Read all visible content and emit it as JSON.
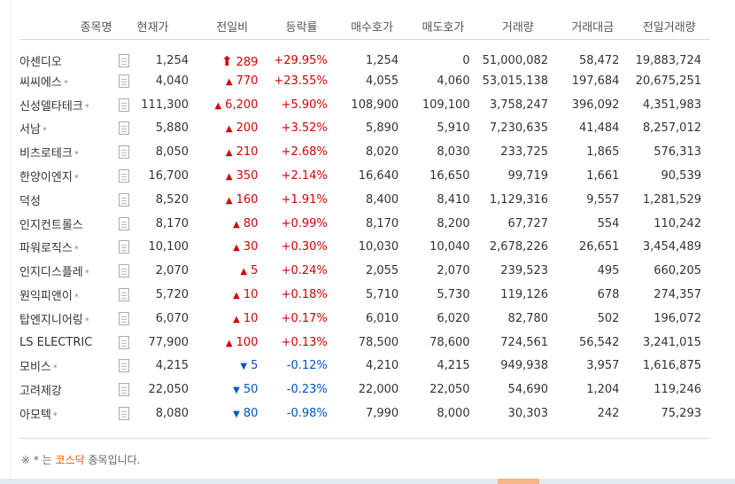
{
  "headers": [
    "종목명",
    "현재가",
    "전일비",
    "등락률",
    "매수호가",
    "매도호가",
    "거래량",
    "거래대금",
    "전일거래량"
  ],
  "rows": [
    {
      "name": "아센디오",
      "kosdaq": false,
      "price": "1,254",
      "dir": "limit",
      "change": "289",
      "rate": "+29.95%",
      "bid": "1,254",
      "ask": "0",
      "volume": "51,000,082",
      "amount": "58,472",
      "prev_volume": "19,883,724"
    },
    {
      "name": "씨씨에스",
      "kosdaq": true,
      "price": "4,040",
      "dir": "up",
      "change": "770",
      "rate": "+23.55%",
      "bid": "4,055",
      "ask": "4,060",
      "volume": "53,015,138",
      "amount": "197,684",
      "prev_volume": "20,675,251"
    },
    {
      "name": "신성델타테크",
      "kosdaq": true,
      "price": "111,300",
      "dir": "up",
      "change": "6,200",
      "rate": "+5.90%",
      "bid": "108,900",
      "ask": "109,100",
      "volume": "3,758,247",
      "amount": "396,092",
      "prev_volume": "4,351,983"
    },
    {
      "name": "서남",
      "kosdaq": true,
      "price": "5,880",
      "dir": "up",
      "change": "200",
      "rate": "+3.52%",
      "bid": "5,890",
      "ask": "5,910",
      "volume": "7,230,635",
      "amount": "41,484",
      "prev_volume": "8,257,012"
    },
    {
      "name": "비츠로테크",
      "kosdaq": true,
      "price": "8,050",
      "dir": "up",
      "change": "210",
      "rate": "+2.68%",
      "bid": "8,020",
      "ask": "8,030",
      "volume": "233,725",
      "amount": "1,865",
      "prev_volume": "576,313"
    },
    {
      "name": "한양이엔지",
      "kosdaq": true,
      "price": "16,700",
      "dir": "up",
      "change": "350",
      "rate": "+2.14%",
      "bid": "16,640",
      "ask": "16,650",
      "volume": "99,719",
      "amount": "1,661",
      "prev_volume": "90,539"
    },
    {
      "name": "덕성",
      "kosdaq": false,
      "price": "8,520",
      "dir": "up",
      "change": "160",
      "rate": "+1.91%",
      "bid": "8,400",
      "ask": "8,410",
      "volume": "1,129,316",
      "amount": "9,557",
      "prev_volume": "1,281,529"
    },
    {
      "name": "인지컨트롤스",
      "kosdaq": false,
      "price": "8,170",
      "dir": "up",
      "change": "80",
      "rate": "+0.99%",
      "bid": "8,170",
      "ask": "8,200",
      "volume": "67,727",
      "amount": "554",
      "prev_volume": "110,242"
    },
    {
      "name": "파워로직스",
      "kosdaq": true,
      "price": "10,100",
      "dir": "up",
      "change": "30",
      "rate": "+0.30%",
      "bid": "10,030",
      "ask": "10,040",
      "volume": "2,678,226",
      "amount": "26,651",
      "prev_volume": "3,454,489"
    },
    {
      "name": "인지디스플레",
      "kosdaq": true,
      "price": "2,070",
      "dir": "up",
      "change": "5",
      "rate": "+0.24%",
      "bid": "2,055",
      "ask": "2,070",
      "volume": "239,523",
      "amount": "495",
      "prev_volume": "660,205"
    },
    {
      "name": "원익피앤이",
      "kosdaq": true,
      "price": "5,720",
      "dir": "up",
      "change": "10",
      "rate": "+0.18%",
      "bid": "5,710",
      "ask": "5,730",
      "volume": "119,126",
      "amount": "678",
      "prev_volume": "274,357"
    },
    {
      "name": "탑엔지니어링",
      "kosdaq": true,
      "price": "6,070",
      "dir": "up",
      "change": "10",
      "rate": "+0.17%",
      "bid": "6,010",
      "ask": "6,020",
      "volume": "82,780",
      "amount": "502",
      "prev_volume": "196,072"
    },
    {
      "name": "LS ELECTRIC",
      "kosdaq": false,
      "price": "77,900",
      "dir": "up",
      "change": "100",
      "rate": "+0.13%",
      "bid": "78,500",
      "ask": "78,600",
      "volume": "724,561",
      "amount": "56,542",
      "prev_volume": "3,241,015"
    },
    {
      "name": "모비스",
      "kosdaq": true,
      "price": "4,215",
      "dir": "down",
      "change": "5",
      "rate": "-0.12%",
      "bid": "4,210",
      "ask": "4,215",
      "volume": "949,938",
      "amount": "3,957",
      "prev_volume": "1,616,875"
    },
    {
      "name": "고려제강",
      "kosdaq": false,
      "price": "22,050",
      "dir": "down",
      "change": "50",
      "rate": "-0.23%",
      "bid": "22,000",
      "ask": "22,050",
      "volume": "54,690",
      "amount": "1,204",
      "prev_volume": "119,246"
    },
    {
      "name": "아모텍",
      "kosdaq": true,
      "price": "8,080",
      "dir": "down",
      "change": "80",
      "rate": "-0.98%",
      "bid": "7,990",
      "ask": "8,000",
      "volume": "30,303",
      "amount": "242",
      "prev_volume": "75,293"
    }
  ],
  "kosdaq_mark": "*",
  "arrows": {
    "limit": "⬆",
    "up": "▲",
    "down": "▼"
  },
  "footnote": {
    "prefix": "※ * 는 ",
    "highlight": "코스닥",
    "suffix": " 종목입니다."
  },
  "colors": {
    "up": "#d60000",
    "down": "#0051c7",
    "highlight": "#e95d00"
  },
  "icons": {
    "document": "document-icon",
    "limit_up": "limit-up-arrow-icon",
    "up": "up-triangle-icon",
    "down": "down-triangle-icon"
  }
}
